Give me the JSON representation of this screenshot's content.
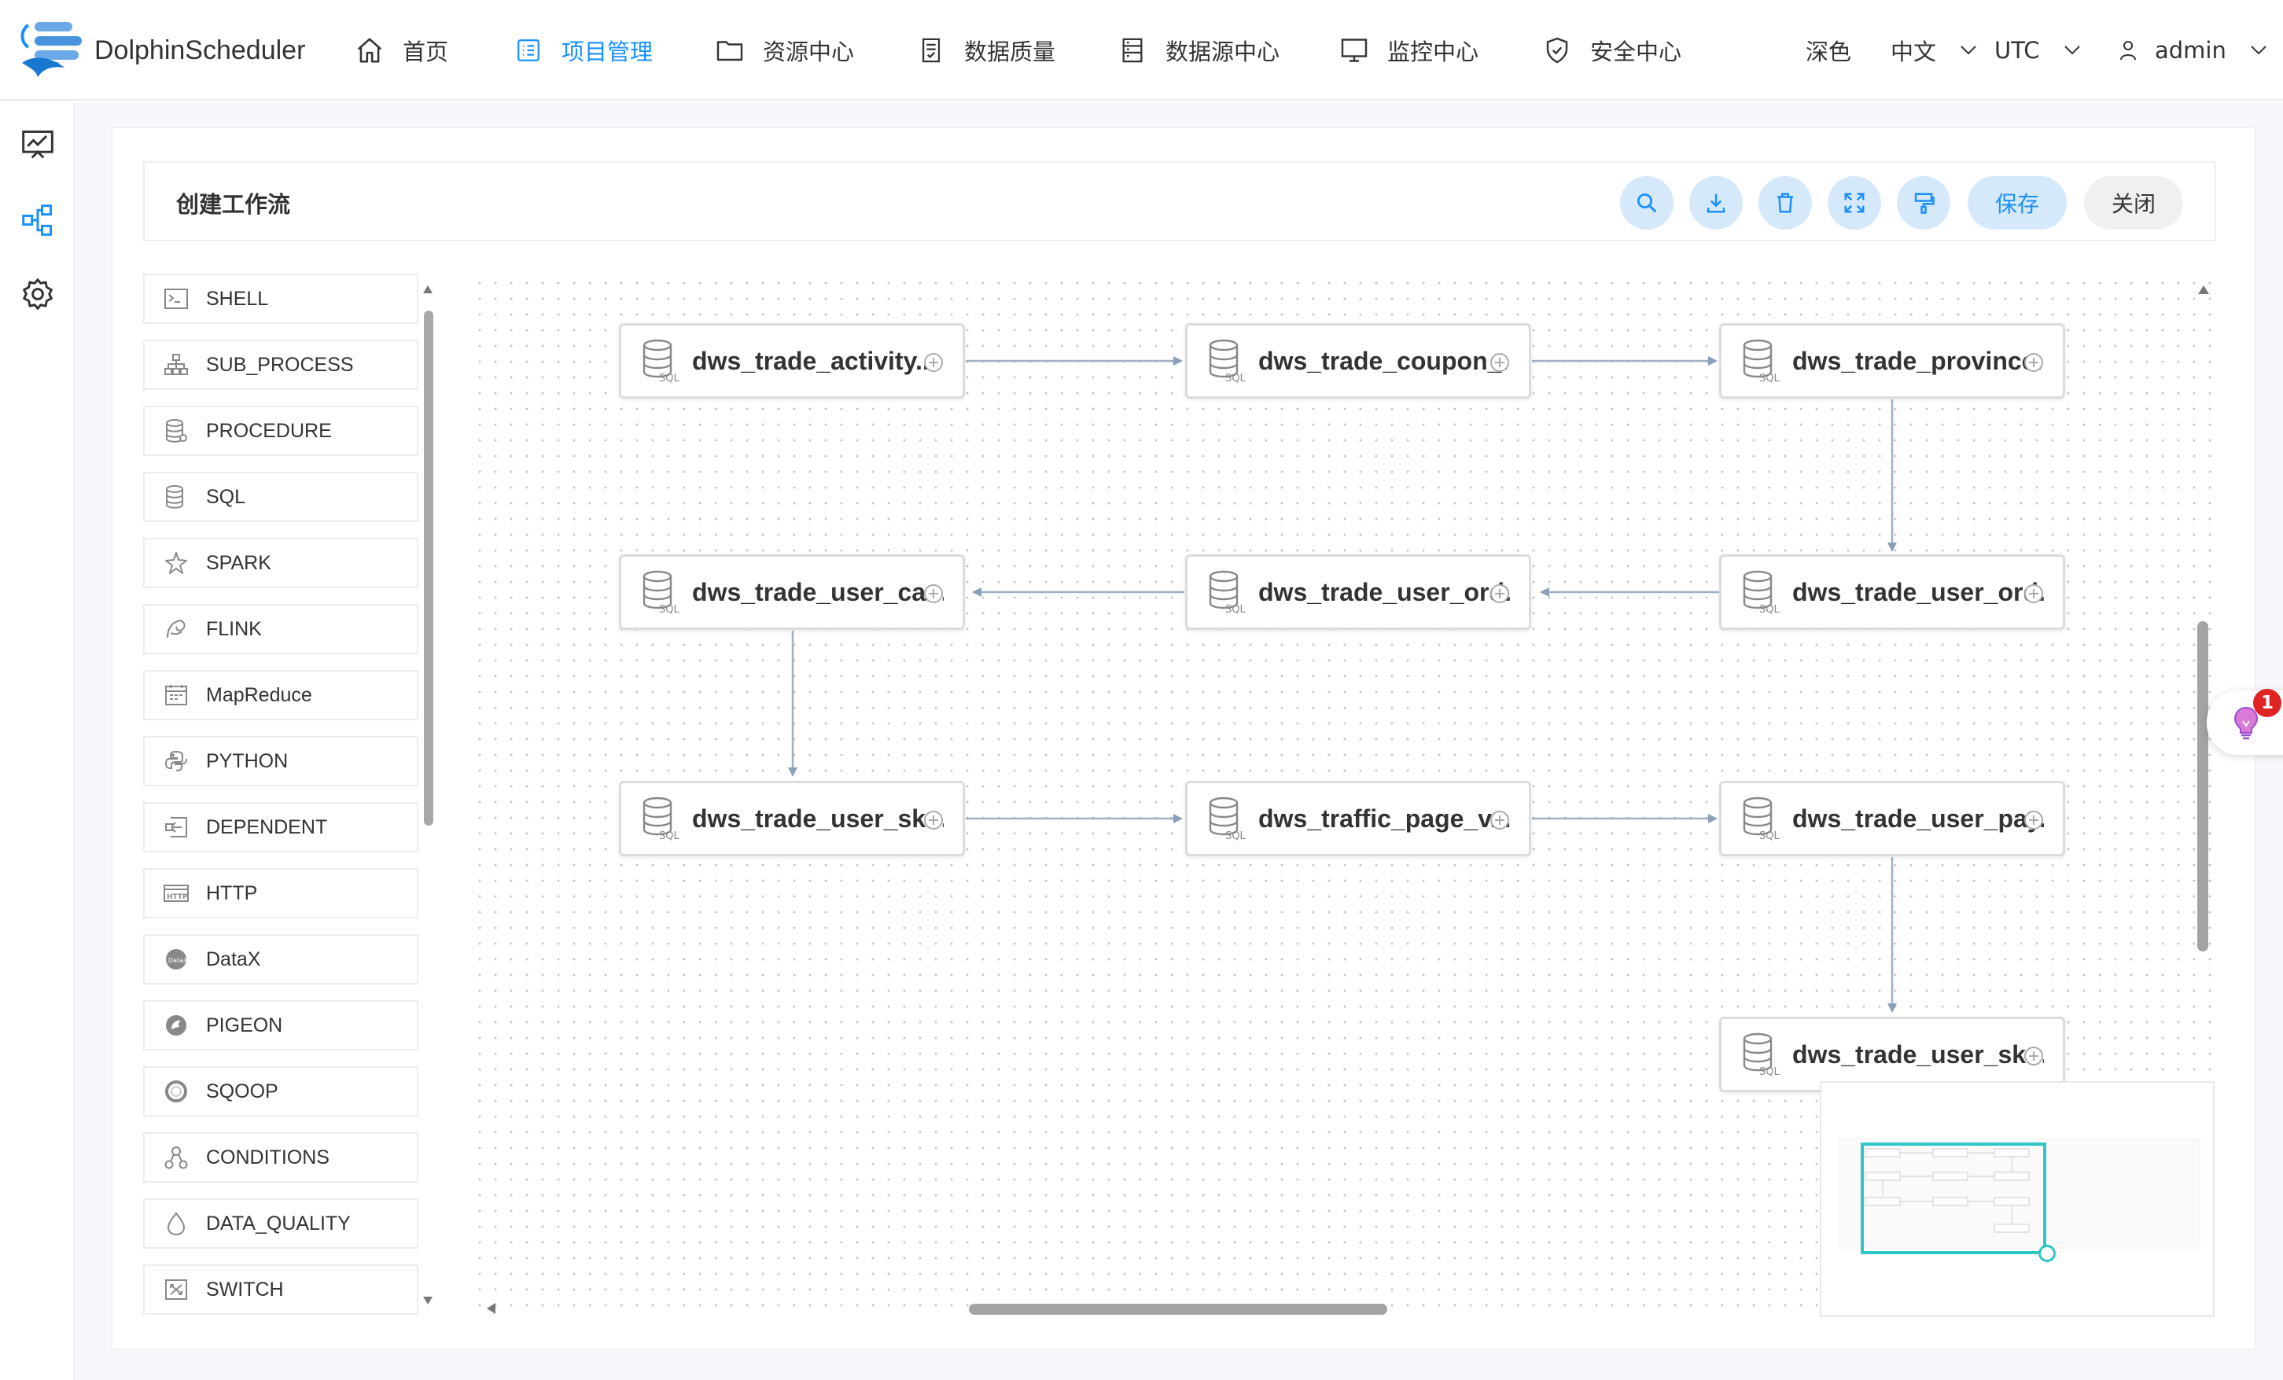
{
  "app": {
    "name": "DolphinScheduler"
  },
  "nav": {
    "items": [
      {
        "label": "首页",
        "icon": "home-icon"
      },
      {
        "label": "项目管理",
        "icon": "project-list-icon",
        "active": true
      },
      {
        "label": "资源中心",
        "icon": "folder-icon"
      },
      {
        "label": "数据质量",
        "icon": "data-quality-icon"
      },
      {
        "label": "数据源中心",
        "icon": "datasource-icon"
      },
      {
        "label": "监控中心",
        "icon": "monitor-icon"
      },
      {
        "label": "安全中心",
        "icon": "shield-icon"
      }
    ],
    "theme": "深色",
    "language": "中文",
    "timezone": "UTC",
    "user": "admin"
  },
  "sidebar": {
    "icons": [
      "dashboard-icon",
      "workflow-icon",
      "settings-icon"
    ]
  },
  "editor": {
    "title": "创建工作流",
    "toolbar": {
      "icons": [
        "search-icon",
        "download-icon",
        "delete-icon",
        "fullscreen-icon",
        "format-icon"
      ],
      "save_label": "保存",
      "close_label": "关闭"
    }
  },
  "palette": {
    "items": [
      {
        "label": "SHELL",
        "icon": "shell-icon"
      },
      {
        "label": "SUB_PROCESS",
        "icon": "sub-process-icon"
      },
      {
        "label": "PROCEDURE",
        "icon": "procedure-icon"
      },
      {
        "label": "SQL",
        "icon": "sql-icon"
      },
      {
        "label": "SPARK",
        "icon": "spark-icon"
      },
      {
        "label": "FLINK",
        "icon": "flink-icon"
      },
      {
        "label": "MapReduce",
        "icon": "mapreduce-icon"
      },
      {
        "label": "PYTHON",
        "icon": "python-icon"
      },
      {
        "label": "DEPENDENT",
        "icon": "dependent-icon"
      },
      {
        "label": "HTTP",
        "icon": "http-icon"
      },
      {
        "label": "DataX",
        "icon": "datax-icon"
      },
      {
        "label": "PIGEON",
        "icon": "pigeon-icon"
      },
      {
        "label": "SQOOP",
        "icon": "sqoop-icon"
      },
      {
        "label": "CONDITIONS",
        "icon": "conditions-icon"
      },
      {
        "label": "DATA_QUALITY",
        "icon": "data-quality-task-icon"
      },
      {
        "label": "SWITCH",
        "icon": "switch-icon"
      }
    ]
  },
  "dag": {
    "nodes": [
      {
        "label": "dws_trade_activity...",
        "type": "SQL"
      },
      {
        "label": "dws_trade_coupon_...",
        "type": "SQL"
      },
      {
        "label": "dws_trade_province...",
        "type": "SQL"
      },
      {
        "label": "dws_trade_user_car...",
        "type": "SQL"
      },
      {
        "label": "dws_trade_user_ord...",
        "type": "SQL"
      },
      {
        "label": "dws_trade_user_ord...",
        "type": "SQL"
      },
      {
        "label": "dws_trade_user_sku...",
        "type": "SQL"
      },
      {
        "label": "dws_traffic_page_v...",
        "type": "SQL"
      },
      {
        "label": "dws_trade_user_pay...",
        "type": "SQL"
      },
      {
        "label": "dws_trade_user_sku...",
        "type": "SQL"
      }
    ],
    "node_icon_tag": "SQL"
  },
  "help": {
    "badge_count": "1"
  },
  "colors": {
    "accent": "#1890ff",
    "minimap": "#2ec7c9",
    "badge": "#e02424"
  }
}
